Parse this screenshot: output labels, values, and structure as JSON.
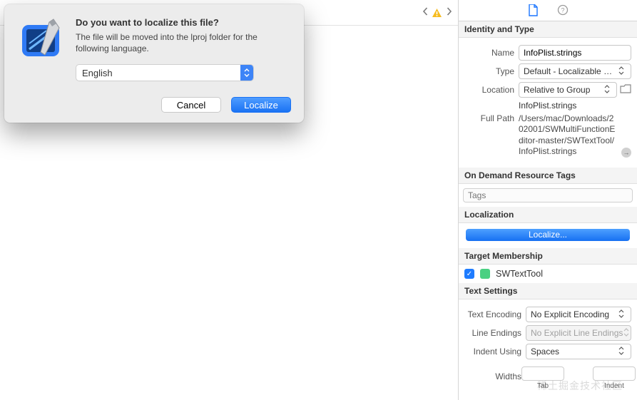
{
  "nav": {
    "warning": true
  },
  "dialog": {
    "title": "Do you want to localize this file?",
    "description": "The file will be moved into the lproj folder for the following language.",
    "language": "English",
    "cancel": "Cancel",
    "confirm": "Localize"
  },
  "inspector": {
    "identity": {
      "header": "Identity and Type",
      "name_label": "Name",
      "name_value": "InfoPlist.strings",
      "type_label": "Type",
      "type_value": "Default - Localizable Strin…",
      "location_label": "Location",
      "location_value": "Relative to Group",
      "location_file": "InfoPlist.strings",
      "fullpath_label": "Full Path",
      "fullpath_value": "/Users/mac/Downloads/202001/SWMultiFunctionEditor-master/SWTextTool/InfoPlist.strings"
    },
    "tags": {
      "header": "On Demand Resource Tags",
      "placeholder": "Tags"
    },
    "localization": {
      "header": "Localization",
      "button": "Localize..."
    },
    "target": {
      "header": "Target Membership",
      "checked": true,
      "name": "SWTextTool"
    },
    "text": {
      "header": "Text Settings",
      "encoding_label": "Text Encoding",
      "encoding_value": "No Explicit Encoding",
      "lineendings_label": "Line Endings",
      "lineendings_value": "No Explicit Line Endings",
      "indent_label": "Indent Using",
      "indent_value": "Spaces",
      "widths_label": "Widths",
      "tab_label": "Tab",
      "indent_col_label": "Indent"
    }
  },
  "watermark": "稀土掘金技术社区"
}
